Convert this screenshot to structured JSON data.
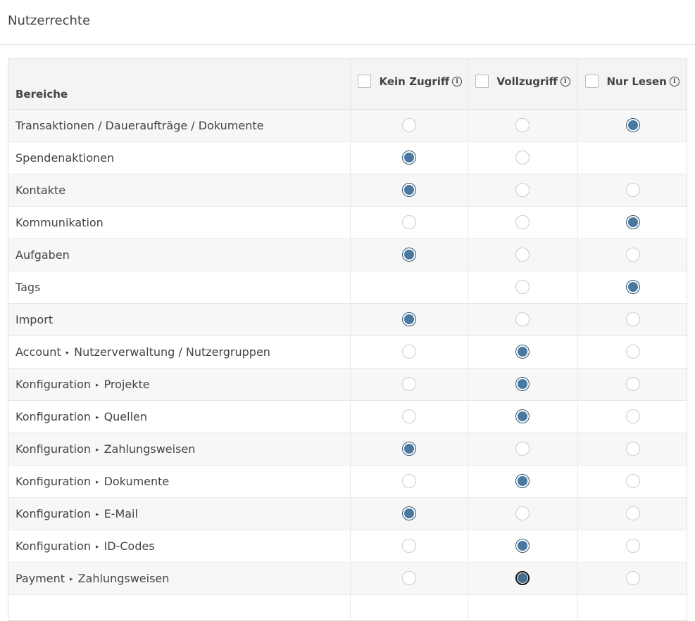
{
  "page": {
    "title": "Nutzerrechte"
  },
  "table": {
    "headers": {
      "area": "Bereiche",
      "columns": [
        {
          "label": "Kein Zugriff",
          "info": "i"
        },
        {
          "label": "Vollzugriff",
          "info": "i"
        },
        {
          "label": "Nur Lesen",
          "info": "i"
        }
      ]
    },
    "rows": [
      {
        "parts": [
          "Transaktionen / Daueraufträge / Dokumente"
        ],
        "selected": 2
      },
      {
        "parts": [
          "Spendenaktionen"
        ],
        "selected": 0
      },
      {
        "parts": [
          "Kontakte"
        ],
        "selected": 0
      },
      {
        "parts": [
          "Kommunikation"
        ],
        "selected": 2
      },
      {
        "parts": [
          "Aufgaben"
        ],
        "selected": 0
      },
      {
        "parts": [
          "Tags"
        ],
        "selected": 2
      },
      {
        "parts": [
          "Import"
        ],
        "selected": 0
      },
      {
        "parts": [
          "Account",
          "Nutzerverwaltung / Nutzergruppen"
        ],
        "selected": 1
      },
      {
        "parts": [
          "Konfiguration",
          "Projekte"
        ],
        "selected": 1
      },
      {
        "parts": [
          "Konfiguration",
          "Quellen"
        ],
        "selected": 1
      },
      {
        "parts": [
          "Konfiguration",
          "Zahlungsweisen"
        ],
        "selected": 0
      },
      {
        "parts": [
          "Konfiguration",
          "Dokumente"
        ],
        "selected": 1
      },
      {
        "parts": [
          "Konfiguration",
          "E-Mail"
        ],
        "selected": 0
      },
      {
        "parts": [
          "Konfiguration",
          "ID-Codes"
        ],
        "selected": 1
      },
      {
        "parts": [
          "Payment",
          "Zahlungsweisen"
        ],
        "selected": 1
      },
      {
        "parts": [
          ""
        ],
        "selected": null
      }
    ]
  }
}
